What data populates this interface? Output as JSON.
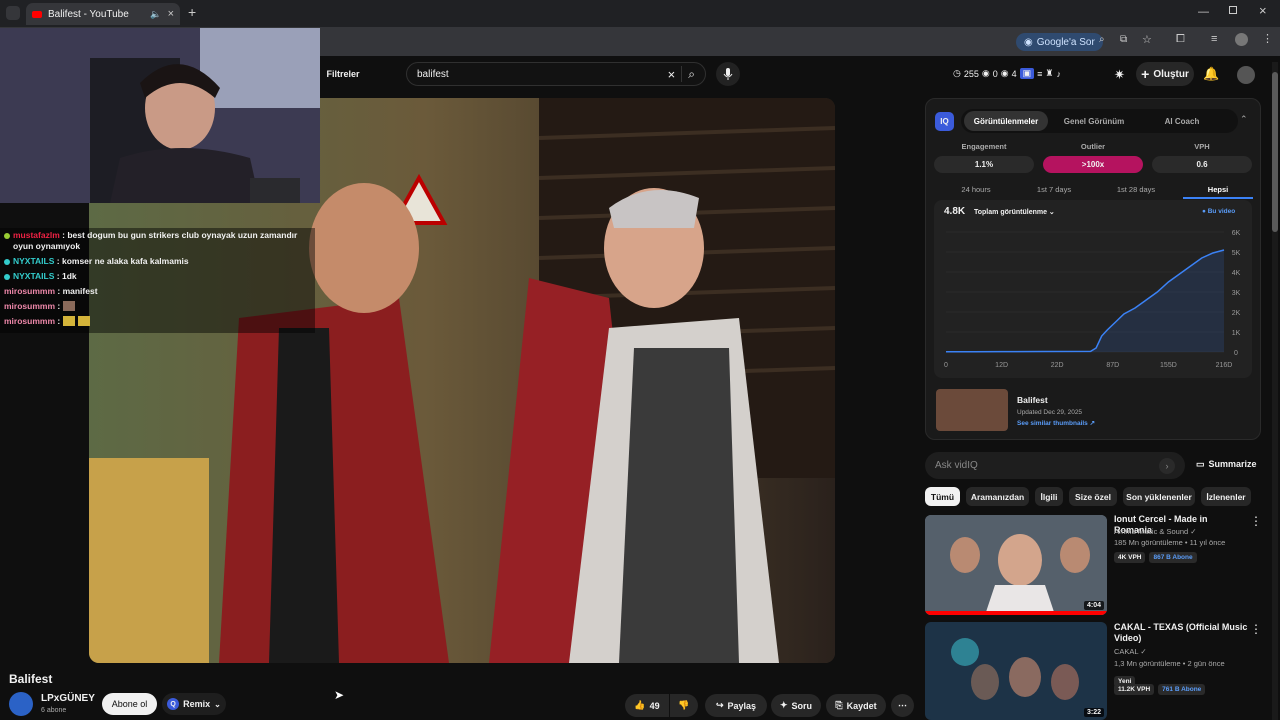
{
  "browser": {
    "tab_title": "Balifest - YouTube",
    "new_tab_label": "+",
    "google_chip": "Google'a Sor"
  },
  "header": {
    "filters_label": "Filtreler",
    "search_value": "balifest",
    "stats": {
      "a": "255",
      "b": "0",
      "c": "4"
    },
    "create_label": "Oluştur"
  },
  "chat": [
    {
      "user": "mustafazlm",
      "color": "#e24",
      "text": "best dogum bu gun strikers club oynayak uzun zamandır oyun oynamıyok",
      "dot": "#9c3"
    },
    {
      "user": "NYXTAILS",
      "color": "#3cc",
      "text": "komser ne alaka kafa kalmamis",
      "dot": "#3cc"
    },
    {
      "user": "NYXTAILS",
      "color": "#3cc",
      "text": "1dk",
      "dot": "#3cc"
    },
    {
      "user": "mirosummm",
      "color": "#e8a",
      "text": "manifest",
      "dot": ""
    },
    {
      "user": "mirosummm",
      "color": "#e8a",
      "text": "",
      "dot": ""
    },
    {
      "user": "mirosummm",
      "color": "#e8a",
      "text": "",
      "dot": ""
    }
  ],
  "video": {
    "title": "Balifest",
    "channel": "LPxGÜNEY",
    "subs": "6 abone",
    "subscribe_label": "Abone ol",
    "remix_label": "Remix",
    "likes": "49",
    "share_label": "Paylaş",
    "ask_label": "Soru",
    "save_label": "Kaydet"
  },
  "vidiq": {
    "logo": "IQ",
    "tabs": [
      "Görüntülenmeler",
      "Genel Görünüm",
      "AI Coach"
    ],
    "metrics": [
      {
        "label": "Engagement",
        "value": "1.1%"
      },
      {
        "label": "Outlier",
        "value": ">100x"
      },
      {
        "label": "VPH",
        "value": "0.6"
      }
    ],
    "periods": [
      "24 hours",
      "1st 7 days",
      "1st 28 days",
      "Hepsi"
    ],
    "views_total": "4.8K",
    "views_label": "Toplam görüntülenme",
    "legend": "Bu video",
    "thumb_title": "Balifest",
    "updated": "Updated Dec 29, 2025",
    "similar_link": "See similar thumbnails ↗",
    "ask_placeholder": "Ask vidIQ",
    "summarize_label": "Summarize",
    "accent": "#3b82f6",
    "outlier_color": "#b5135f"
  },
  "chart_data": {
    "type": "area",
    "x_ticks": [
      "0",
      "12D",
      "22D",
      "87D",
      "155D",
      "216D"
    ],
    "y_ticks": [
      "0",
      "1K",
      "2K",
      "3K",
      "4K",
      "5K",
      "6K"
    ],
    "ylim": [
      0,
      6000
    ],
    "series": [
      {
        "name": "Bu video",
        "points": [
          [
            0,
            10
          ],
          [
            0.1,
            15
          ],
          [
            0.2,
            18
          ],
          [
            0.35,
            22
          ],
          [
            0.52,
            30
          ],
          [
            0.54,
            200
          ],
          [
            0.56,
            800
          ],
          [
            0.58,
            1100
          ],
          [
            0.61,
            1500
          ],
          [
            0.64,
            1900
          ],
          [
            0.68,
            2200
          ],
          [
            0.72,
            2600
          ],
          [
            0.76,
            3000
          ],
          [
            0.8,
            3500
          ],
          [
            0.84,
            3900
          ],
          [
            0.88,
            4300
          ],
          [
            0.92,
            4700
          ],
          [
            0.96,
            4950
          ],
          [
            1,
            5100
          ]
        ]
      }
    ]
  },
  "filter_chips": [
    "Tümü",
    "Aramanızdan",
    "İlgili",
    "Size özel",
    "Son yüklenenler",
    "İzlenenler"
  ],
  "recommendations": [
    {
      "title": "Ionut Cercel - Made in Romania",
      "channel": "Amma Music & Sound",
      "meta": "185 Mn görüntüleme • 11 yıl önce",
      "vph": "4K VPH",
      "subs": "867 B Abone",
      "duration": "4:04",
      "extra": "",
      "thumb": "#6b7a8a"
    },
    {
      "title": "CAKAL - TEXAS (Official Music Video)",
      "channel": "CAKAL",
      "meta": "1,3 Mn görüntüleme • 2 gün önce",
      "vph": "11.2K VPH",
      "subs": "761 B Abone",
      "duration": "3:22",
      "extra": "Yeni",
      "thumb": "#1d3347"
    }
  ]
}
